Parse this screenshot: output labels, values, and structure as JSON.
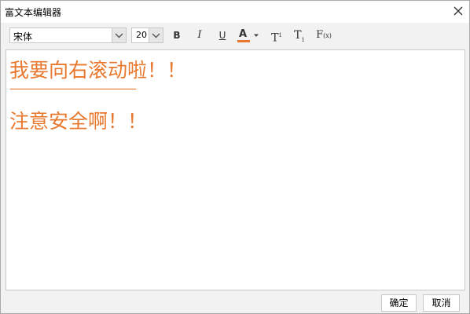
{
  "window": {
    "title": "富文本编辑器"
  },
  "toolbar": {
    "font_family": "宋体",
    "font_size": "20",
    "bold_label": "B",
    "italic_label": "I",
    "underline_label": "U",
    "font_color_label": "A",
    "font_color": "#e8782e",
    "superscript_label": "T",
    "superscript_mark": "1",
    "subscript_label": "T",
    "subscript_mark": "1",
    "formula_label": "F",
    "formula_mark": "(x)"
  },
  "editor": {
    "lines": [
      "我要向右滚动啦！！",
      "——————————",
      "注意安全啊！！"
    ],
    "text_color": "#e8782e"
  },
  "footer": {
    "confirm_label": "确定",
    "cancel_label": "取消"
  },
  "icons": {
    "close": "close-icon",
    "dropdown": "chevron-down-icon",
    "color_dropdown": "caret-down-icon"
  }
}
